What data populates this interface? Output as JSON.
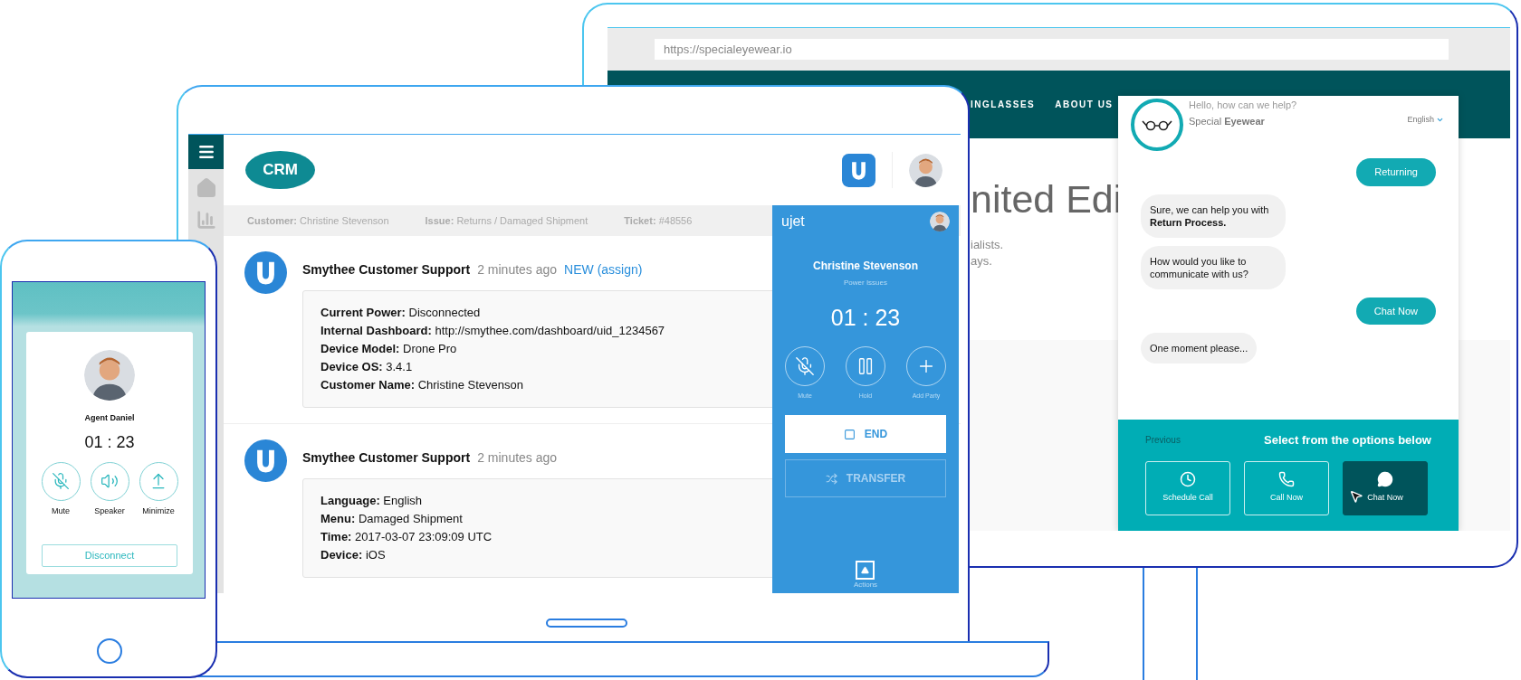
{
  "monitor": {
    "url": "https://specialeyewear.io",
    "nav": [
      "INGLASSES",
      "ABOUT US"
    ],
    "hero": {
      "heading": "nited Edi",
      "lines": [
        "ialists.",
        "ays."
      ]
    },
    "chat": {
      "greeting": "Hello, how can we help?",
      "brand": "Special **Eyewear**",
      "language": "English",
      "messages": [
        {
          "kind": "reply",
          "text": "Returning"
        },
        {
          "kind": "message",
          "text": "Sure, we can help you with **Return Process.**"
        },
        {
          "kind": "message",
          "text": "How would you like to communicate with us?"
        },
        {
          "kind": "reply",
          "text": "Chat Now"
        },
        {
          "kind": "message",
          "text": "One moment please..."
        }
      ],
      "previous": "Previous",
      "prompt": "Select from the options below",
      "options": [
        {
          "label": "Schedule Call",
          "selected": false
        },
        {
          "label": "Call Now",
          "selected": false
        },
        {
          "label": "Chat Now",
          "selected": true
        }
      ]
    }
  },
  "laptop": {
    "logo": "CRM",
    "info": [
      {
        "label": "Customer:",
        "value": "Christine Stevenson"
      },
      {
        "label": "Issue:",
        "value": "Returns / Damaged Shipment"
      },
      {
        "label": "Ticket:",
        "value": "#48556"
      }
    ],
    "posts": [
      {
        "author": "Smythee Customer Support",
        "time": "2 minutes ago",
        "badge": "NEW (assign)",
        "fields": [
          {
            "label": "Current Power:",
            "value": "Disconnected"
          },
          {
            "label": "Internal Dashboard:",
            "value": "http://smythee.com/dashboard/uid_1234567"
          },
          {
            "label": "Device Model:",
            "value": "Drone Pro"
          },
          {
            "label": "Device OS:",
            "value": "3.4.1"
          },
          {
            "label": "Customer Name:",
            "value": "Christine Stevenson"
          }
        ]
      },
      {
        "author": "Smythee Customer Support",
        "time": "2 minutes ago",
        "fields": [
          {
            "label": "Language:",
            "value": "English"
          },
          {
            "label": "Menu:",
            "value": "Damaged Shipment"
          },
          {
            "label": "Time:",
            "value": "2017-03-07 23:09:09 UTC"
          },
          {
            "label": "Device:",
            "value": "iOS"
          }
        ]
      }
    ],
    "call_panel": {
      "brand": "ujet",
      "caller": "Christine Stevenson",
      "topic": "Power Issues",
      "timer": "01 : 23",
      "controls": [
        "Mute",
        "Hold",
        "Add Party"
      ],
      "end": "END",
      "transfer": {
        "label": "TRANSFER",
        "disabled": true
      },
      "actions": "Actions"
    }
  },
  "phone": {
    "agent": "Agent Daniel",
    "timer": "01 : 23",
    "controls": [
      "Mute",
      "Speaker",
      "Minimize"
    ],
    "disconnect": "Disconnect"
  }
}
